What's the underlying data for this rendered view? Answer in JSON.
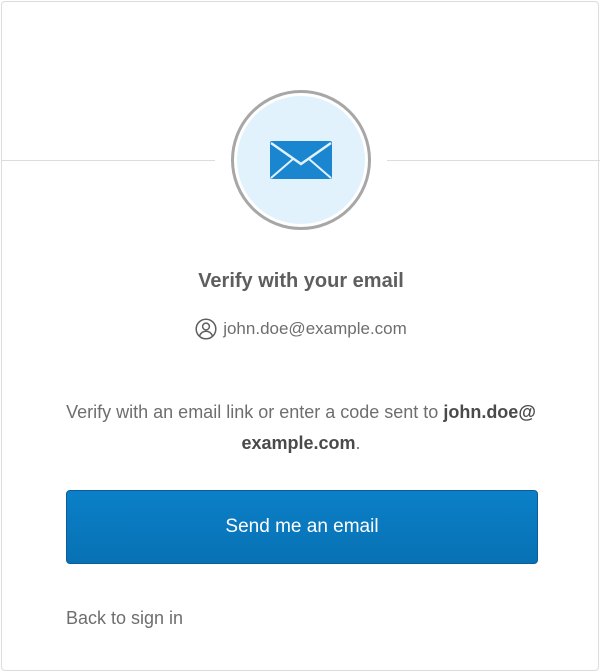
{
  "header": {
    "icon": "email-envelope-icon",
    "beacon_bg": "#e1f2fd",
    "accent": "#0b80c8"
  },
  "title": "Verify with your email",
  "identifier": {
    "icon": "user-circle-icon",
    "email": "john.doe@example.com"
  },
  "instructions": {
    "prefix": "Verify with an email link or enter a code sent to ",
    "email": "john.doe@example.com",
    "suffix": "."
  },
  "actions": {
    "send_label": "Send me an email",
    "back_label": "Back to sign in"
  }
}
